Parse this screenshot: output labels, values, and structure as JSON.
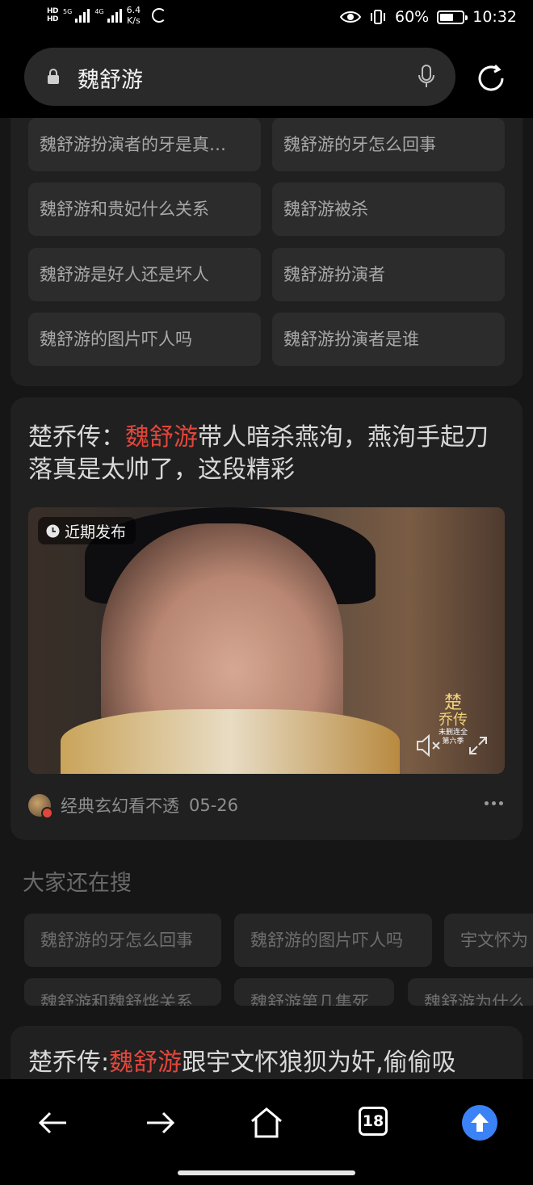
{
  "status_bar": {
    "hd1": "HD",
    "hd2": "HD",
    "network": "5G",
    "network2": "4G",
    "speed_value": "6.4",
    "speed_unit": "K/s",
    "battery": "60%",
    "time": "10:32"
  },
  "search": {
    "query": "魏舒游"
  },
  "related_chips": [
    "魏舒游扮演者的牙是真…",
    "魏舒游的牙怎么回事",
    "魏舒游和贵妃什么关系",
    "魏舒游被杀",
    "魏舒游是好人还是坏人",
    "魏舒游扮演者",
    "魏舒游的图片吓人吗",
    "魏舒游扮演者是谁"
  ],
  "news1": {
    "title_prefix": "楚乔传：",
    "title_highlight": "魏舒游",
    "title_suffix": "带人暗杀燕洵，燕洵手起刀落真是太帅了，这段精彩",
    "badge": "近期发布",
    "watermark_line1": "楚",
    "watermark_line2": "乔传",
    "watermark_line3": "未删连全",
    "watermark_line4": "第六季",
    "author": "经典玄幻看不透",
    "date": "05-26"
  },
  "also_search": {
    "title": "大家还在搜",
    "row1": [
      "魏舒游的牙怎么回事",
      "魏舒游的图片吓人吗",
      "宇文怀为"
    ],
    "row2": [
      "魏舒游和魏舒烨关系",
      "魏舒游第几集死",
      "魏舒游为什么"
    ]
  },
  "news2": {
    "title_prefix": "楚乔传:",
    "title_highlight": "魏舒游",
    "title_suffix": "跟宇文怀狼狈为奸,偷偷吸"
  },
  "bottom_nav": {
    "tab_count": "18"
  },
  "colors": {
    "highlight": "#e2463b",
    "accent": "#3b82f6"
  }
}
